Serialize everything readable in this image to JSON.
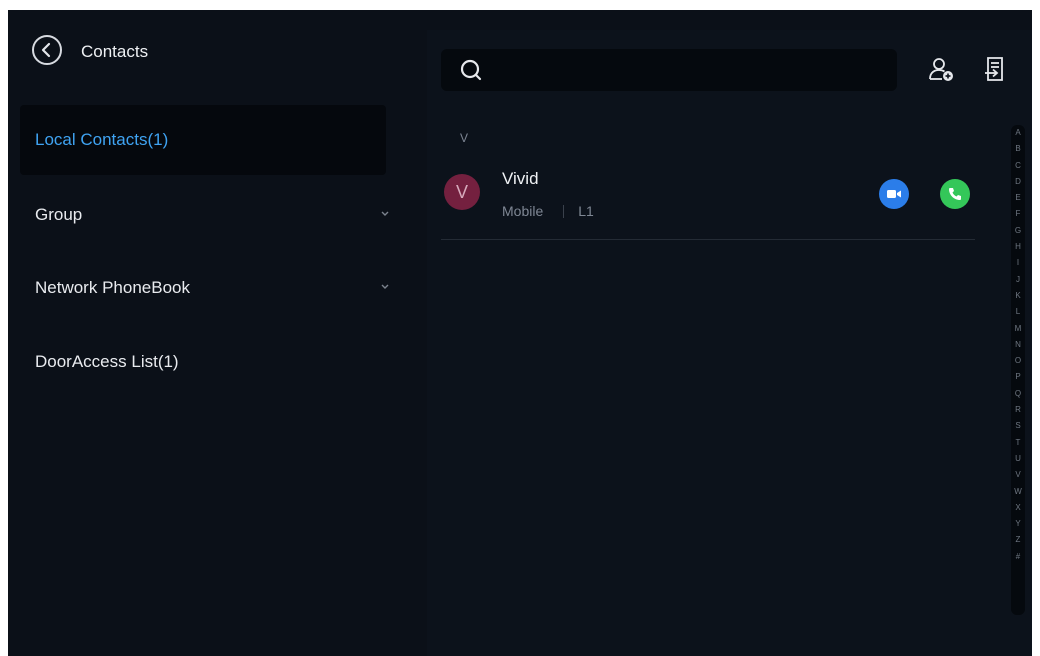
{
  "header": {
    "title": "Contacts"
  },
  "nav": {
    "items": [
      {
        "label": "Local Contacts(1)"
      },
      {
        "label": "Group"
      },
      {
        "label": "Network PhoneBook"
      },
      {
        "label": "DoorAccess List(1)"
      }
    ]
  },
  "search": {
    "value": "",
    "placeholder": ""
  },
  "contacts": {
    "section_letter": "V",
    "items": [
      {
        "initial": "V",
        "name": "Vivid",
        "type": "Mobile",
        "line": "L1"
      }
    ]
  },
  "alphabet": [
    "A",
    "B",
    "C",
    "D",
    "E",
    "F",
    "G",
    "H",
    "I",
    "J",
    "K",
    "L",
    "M",
    "N",
    "O",
    "P",
    "Q",
    "R",
    "S",
    "T",
    "U",
    "V",
    "W",
    "X",
    "Y",
    "Z",
    "#"
  ],
  "colors": {
    "accent": "#3fa3f2",
    "video": "#2b7de9",
    "call": "#34c759",
    "avatar": "#74203f"
  }
}
